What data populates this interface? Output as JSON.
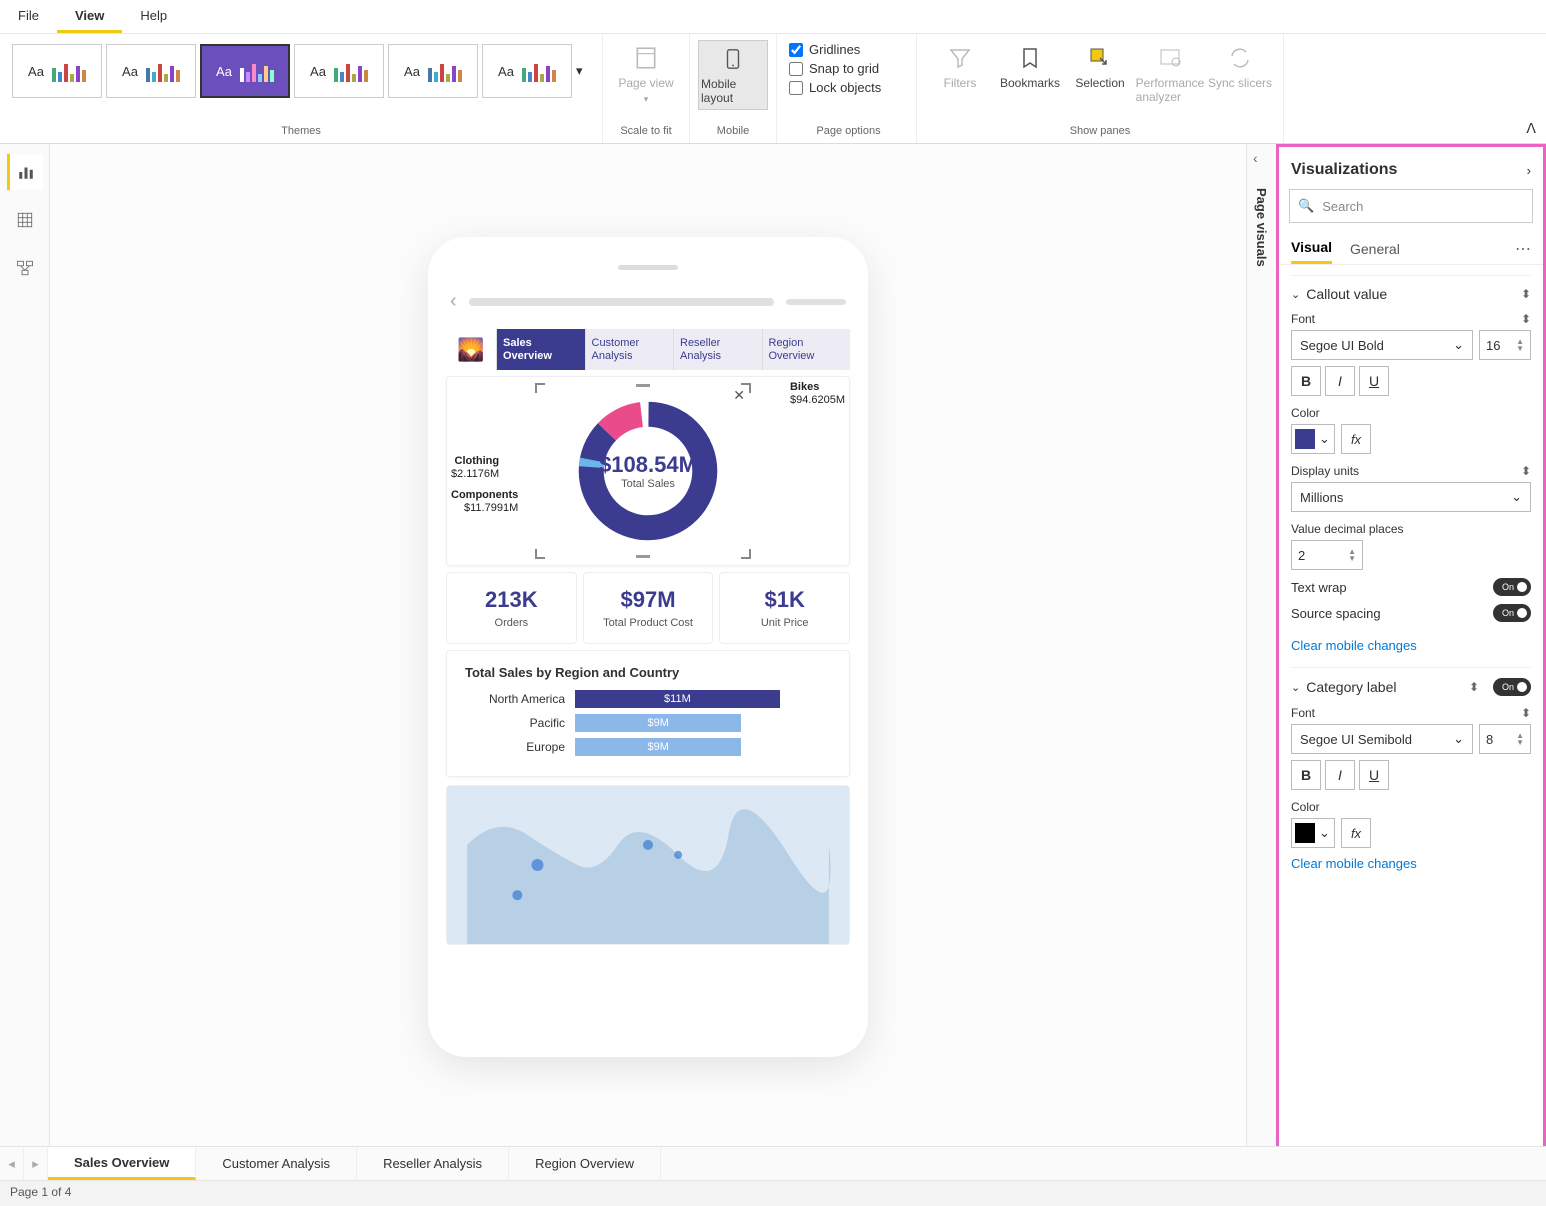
{
  "menu": {
    "file": "File",
    "view": "View",
    "help": "Help"
  },
  "ribbon": {
    "themes_label": "Themes",
    "scale_to_fit": "Scale to fit",
    "page_view": "Page view",
    "mobile_group": "Mobile",
    "mobile_layout": "Mobile layout",
    "page_options": "Page options",
    "gridlines": "Gridlines",
    "snap_to_grid": "Snap to grid",
    "lock_objects": "Lock objects",
    "show_panes": "Show panes",
    "filters": "Filters",
    "bookmarks": "Bookmarks",
    "selection": "Selection",
    "perf": "Performance analyzer",
    "sync": "Sync slicers"
  },
  "collapsed_pane": "Page visuals",
  "phone": {
    "tabs": [
      {
        "l1": "Sales",
        "l2": "Overview"
      },
      {
        "l1": "Customer",
        "l2": "Analysis"
      },
      {
        "l1": "Reseller",
        "l2": "Analysis"
      },
      {
        "l1": "Region",
        "l2": "Overview"
      }
    ],
    "donut": {
      "center_value": "$108.54M",
      "center_label": "Total Sales",
      "labels": {
        "bikes_name": "Bikes",
        "bikes_amt": "$94.6205M",
        "clothing_name": "Clothing",
        "clothing_amt": "$2.1176M",
        "components_name": "Components",
        "components_amt": "$11.7991M"
      }
    },
    "kpis": [
      {
        "v": "213K",
        "l": "Orders"
      },
      {
        "v": "$97M",
        "l": "Total Product Cost"
      },
      {
        "v": "$1K",
        "l": "Unit Price"
      }
    ],
    "bar_title": "Total Sales by Region and Country"
  },
  "chart_data": {
    "type": "bar",
    "title": "Total Sales by Region and Country",
    "categories": [
      "North America",
      "Pacific",
      "Europe"
    ],
    "values": [
      11,
      9,
      9
    ],
    "value_labels": [
      "$11M",
      "$9M",
      "$9M"
    ],
    "colors": [
      "#3b3b8f",
      "#8bb8e8",
      "#8bb8e8"
    ],
    "xlabel": "",
    "ylabel": "",
    "ylim": [
      0,
      12
    ]
  },
  "viz": {
    "title": "Visualizations",
    "search_placeholder": "Search",
    "tab_visual": "Visual",
    "tab_general": "General",
    "sections": {
      "callout": {
        "title": "Callout value",
        "font_label": "Font",
        "font_family": "Segoe UI Bold",
        "font_size": "16",
        "color_label": "Color",
        "color_hex": "#3b3b8f",
        "display_units_label": "Display units",
        "display_units": "Millions",
        "decimals_label": "Value decimal places",
        "decimals": "2",
        "text_wrap": "Text wrap",
        "source_spacing": "Source spacing",
        "clear": "Clear mobile changes",
        "toggle_on": "On"
      },
      "category": {
        "title": "Category label",
        "font_label": "Font",
        "font_family": "Segoe UI Semibold",
        "font_size": "8",
        "color_label": "Color",
        "color_hex": "#000000",
        "clear": "Clear mobile changes",
        "toggle_on": "On"
      }
    }
  },
  "pages": [
    "Sales Overview",
    "Customer Analysis",
    "Reseller Analysis",
    "Region Overview"
  ],
  "status": "Page 1 of 4"
}
